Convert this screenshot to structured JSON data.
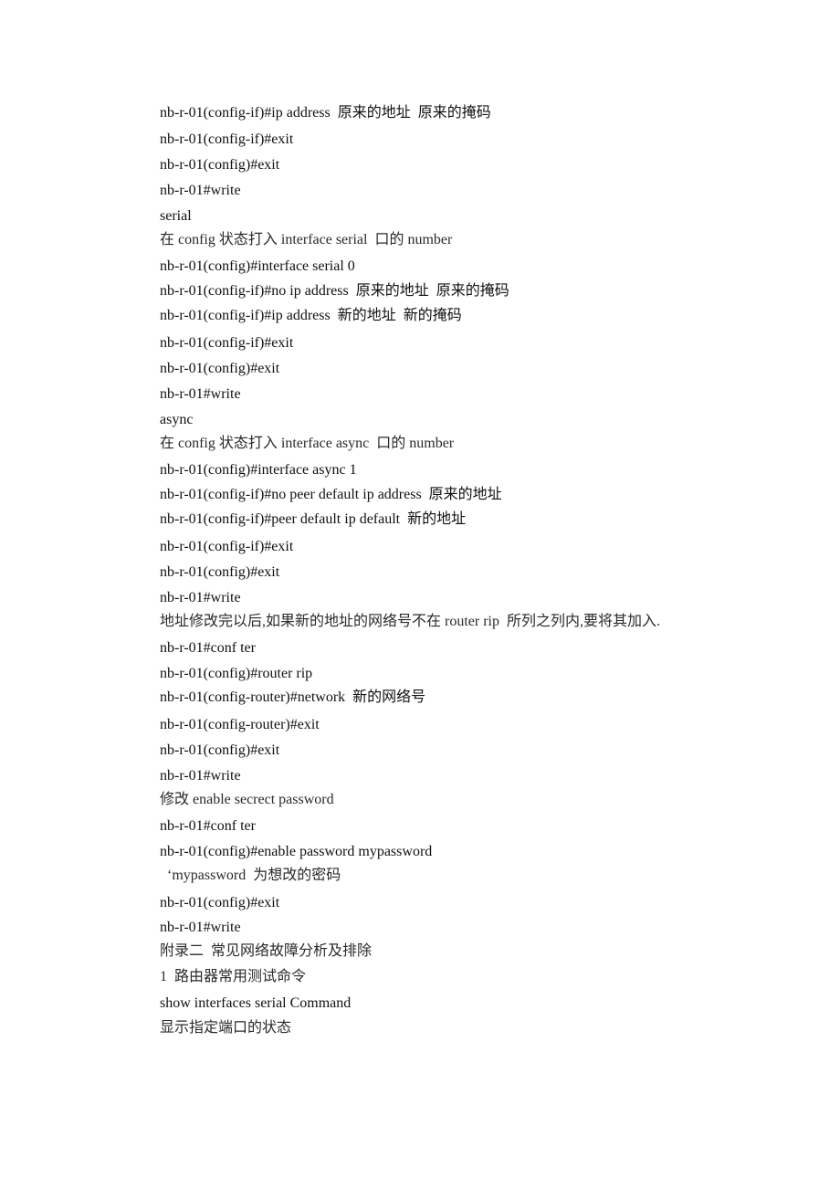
{
  "document": {
    "lines": [
      {
        "text": "nb-r-01(config-if)#ip address  原来的地址  原来的掩码",
        "kind": "command"
      },
      {
        "text": "nb-r-01(config-if)#exit",
        "kind": "command"
      },
      {
        "text": "nb-r-01(config)#exit",
        "kind": "command"
      },
      {
        "text": "nb-r-01#write",
        "kind": "command"
      },
      {
        "text": "serial",
        "kind": "heading"
      },
      {
        "text": "在 config 状态打入 interface serial  口的 number",
        "kind": "note"
      },
      {
        "text": "nb-r-01(config)#interface serial 0",
        "kind": "command"
      },
      {
        "text": "nb-r-01(config-if)#no ip address  原来的地址  原来的掩码",
        "kind": "command"
      },
      {
        "text": "nb-r-01(config-if)#ip address  新的地址  新的掩码",
        "kind": "command"
      },
      {
        "text": "nb-r-01(config-if)#exit",
        "kind": "command"
      },
      {
        "text": "nb-r-01(config)#exit",
        "kind": "command"
      },
      {
        "text": "nb-r-01#write",
        "kind": "command"
      },
      {
        "text": "async",
        "kind": "heading"
      },
      {
        "text": "在 config 状态打入 interface async  口的 number",
        "kind": "note"
      },
      {
        "text": "nb-r-01(config)#interface async 1",
        "kind": "command"
      },
      {
        "text": "nb-r-01(config-if)#no peer default ip address  原来的地址",
        "kind": "command"
      },
      {
        "text": "nb-r-01(config-if)#peer default ip default  新的地址",
        "kind": "command"
      },
      {
        "text": "nb-r-01(config-if)#exit",
        "kind": "command"
      },
      {
        "text": "nb-r-01(config)#exit",
        "kind": "command"
      },
      {
        "text": "nb-r-01#write",
        "kind": "command"
      },
      {
        "text": "地址修改完以后,如果新的地址的网络号不在 router rip  所列之列内,要将其加入.",
        "kind": "note"
      },
      {
        "text": "nb-r-01#conf ter",
        "kind": "command"
      },
      {
        "text": "nb-r-01(config)#router rip",
        "kind": "command"
      },
      {
        "text": "nb-r-01(config-router)#network  新的网络号",
        "kind": "command"
      },
      {
        "text": "nb-r-01(config-router)#exit",
        "kind": "command"
      },
      {
        "text": "nb-r-01(config)#exit",
        "kind": "command"
      },
      {
        "text": "nb-r-01#write",
        "kind": "command"
      },
      {
        "text": "修改 enable secrect password",
        "kind": "note"
      },
      {
        "text": "nb-r-01#conf ter",
        "kind": "command"
      },
      {
        "text": "nb-r-01(config)#enable password mypassword",
        "kind": "command"
      },
      {
        "text": "  ‘mypassword  为想改的密码",
        "kind": "note"
      },
      {
        "text": "nb-r-01(config)#exit",
        "kind": "command"
      },
      {
        "text": "nb-r-01#write",
        "kind": "command"
      },
      {
        "text": "附录二  常见网络故障分析及排除",
        "kind": "section-title"
      },
      {
        "text": "1  路由器常用测试命令",
        "kind": "subsection-title"
      },
      {
        "text": "show interfaces serial Command",
        "kind": "command"
      },
      {
        "text": "显示指定端口的状态",
        "kind": "note"
      }
    ]
  }
}
